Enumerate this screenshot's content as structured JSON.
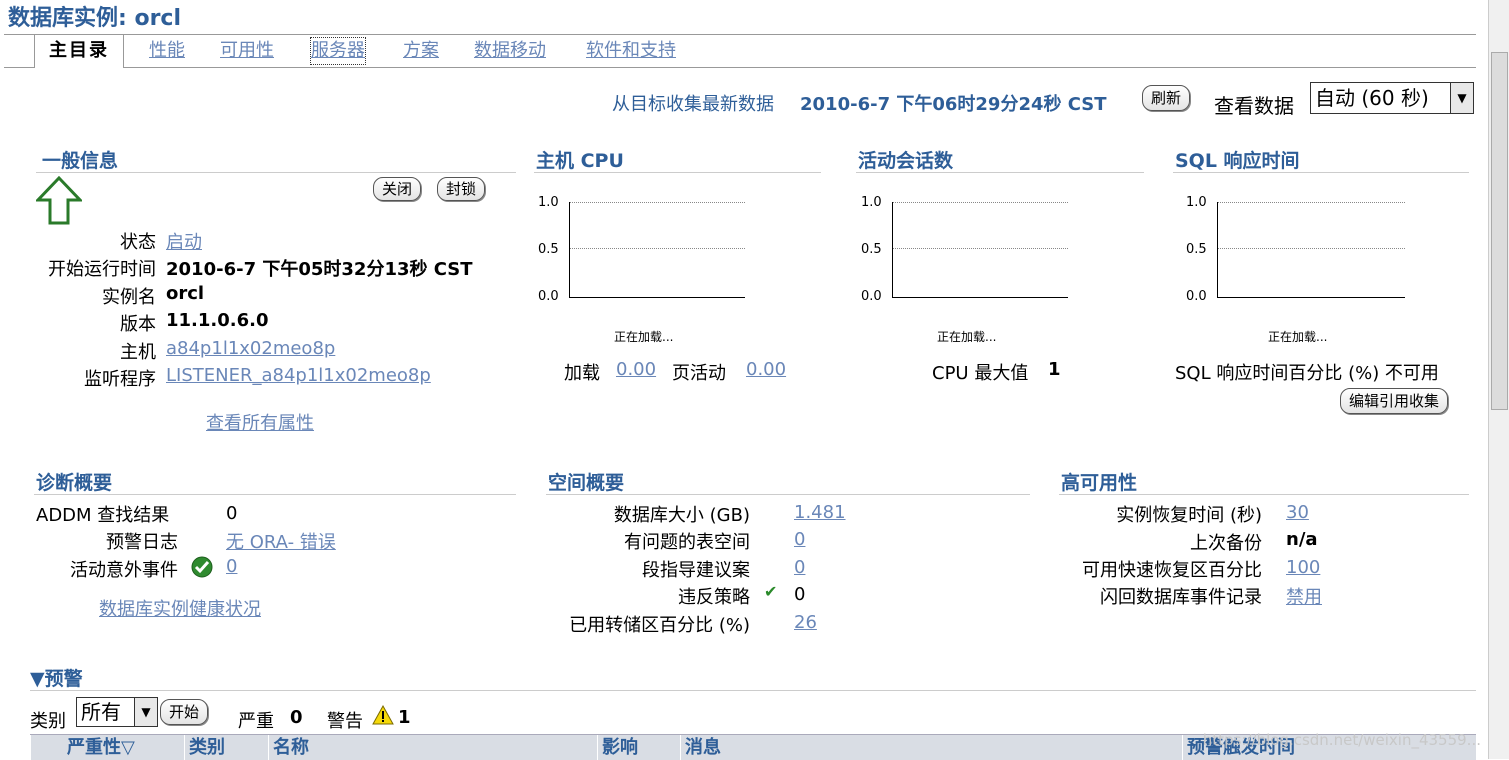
{
  "header": {
    "title": "数据库实例: orcl"
  },
  "tabs": [
    {
      "label": "主目录"
    },
    {
      "label": "性能"
    },
    {
      "label": "可用性"
    },
    {
      "label": "服务器"
    },
    {
      "label": "方案"
    },
    {
      "label": "数据移动"
    },
    {
      "label": "软件和支持"
    }
  ],
  "refresh": {
    "text": "从目标收集最新数据",
    "timestamp": "2010-6-7 下午06时29分24秒 CST",
    "button": "刷新",
    "view_label": "查看数据",
    "view_value": "自动 (60 秒)"
  },
  "general": {
    "title": "一般信息",
    "close_button": "关闭",
    "block_button": "封锁",
    "rows": [
      {
        "label": "状态",
        "value": "启动"
      },
      {
        "label": "开始运行时间",
        "value": "2010-6-7 下午05时32分13秒 CST"
      },
      {
        "label": "实例名",
        "value": "orcl"
      },
      {
        "label": "版本",
        "value": "11.1.0.6.0"
      },
      {
        "label": "主机",
        "value": "a84p1l1x02meo8p"
      },
      {
        "label": "监听程序",
        "value": "LISTENER_a84p1l1x02meo8p"
      }
    ],
    "all_props_link": "查看所有属性"
  },
  "charts": [
    {
      "title": "主机 CPU",
      "loading": "正在加载..."
    },
    {
      "title": "活动会话数",
      "loading": "正在加载..."
    },
    {
      "title": "SQL 响应时间",
      "loading": "正在加载..."
    }
  ],
  "chart_ticks": [
    "1.0",
    "0.5",
    "0.0"
  ],
  "cpu_metrics": {
    "load_label": "加载",
    "load_value": "0.00",
    "page_label": "页活动",
    "page_value": "0.00"
  },
  "session_metrics": {
    "max_label": "CPU 最大值",
    "max_value": "1"
  },
  "sql_metrics": {
    "text": "SQL 响应时间百分比 (%) 不可用",
    "button": "编辑引用收集"
  },
  "diagnostics": {
    "title": "诊断概要",
    "addm_label": "ADDM 查找结果",
    "addm_value": "0",
    "alert_log_label": "预警日志",
    "alert_log_value": "无 ORA- 错误",
    "incident_label": "活动意外事件",
    "incident_value": "0",
    "health_link": "数据库实例健康状况"
  },
  "space": {
    "title": "空间概要",
    "rows": [
      {
        "label": "数据库大小 (GB)",
        "value": "1.481"
      },
      {
        "label": "有问题的表空间",
        "value": "0"
      },
      {
        "label": "段指导建议案",
        "value": "0"
      },
      {
        "label": "违反策略",
        "value": "0"
      },
      {
        "label": "已用转储区百分比 (%)",
        "value": "26"
      }
    ]
  },
  "ha": {
    "title": "高可用性",
    "rows": [
      {
        "label": "实例恢复时间 (秒)",
        "value": "30"
      },
      {
        "label": "上次备份",
        "value": "n/a"
      },
      {
        "label": "可用快速恢复区百分比",
        "value": "100"
      },
      {
        "label": "闪回数据库事件记录",
        "value": "禁用"
      }
    ]
  },
  "alerts": {
    "title": "▼预警",
    "category_label": "类别",
    "category_value": "所有",
    "start_button": "开始",
    "critical_label": "严重",
    "critical_value": "0",
    "warning_label": "警告",
    "warning_value": "1",
    "columns": [
      "严重性▽",
      "类别",
      "名称",
      "影响",
      "消息",
      "预警触发时间"
    ]
  },
  "watermark": "https://blog.csdn.net/weixin_43559..."
}
